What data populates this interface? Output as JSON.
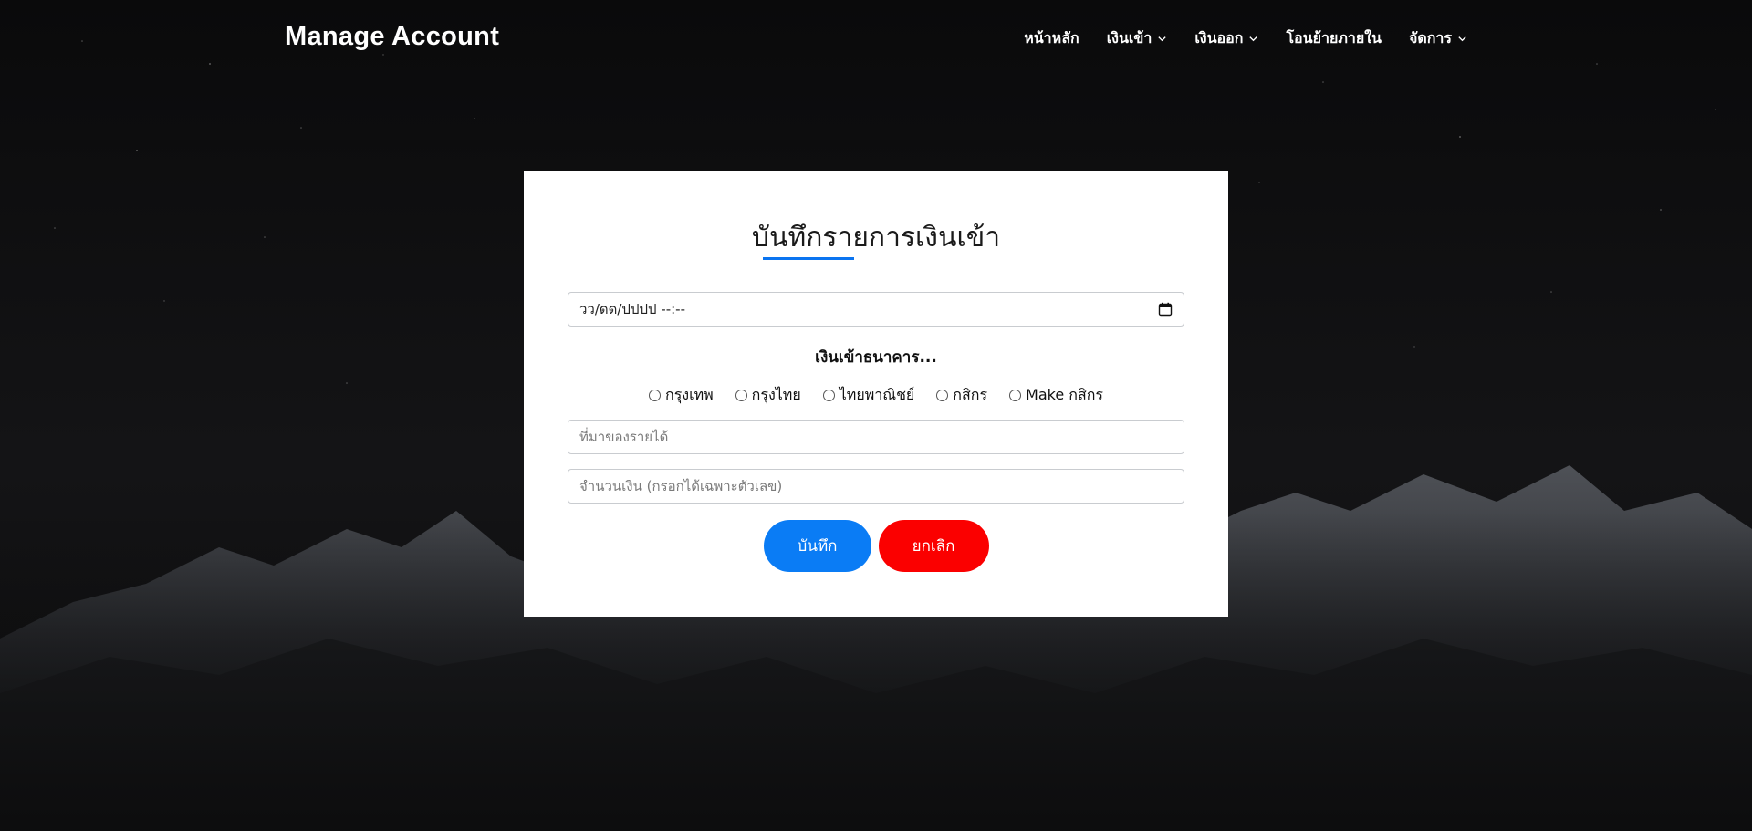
{
  "navbar": {
    "brand": "Manage Account",
    "items": [
      {
        "label": "หน้าหลัก",
        "dropdown": false
      },
      {
        "label": "เงินเข้า",
        "dropdown": true
      },
      {
        "label": "เงินออก",
        "dropdown": true
      },
      {
        "label": "โอนย้ายภายใน",
        "dropdown": false
      },
      {
        "label": "จัดการ",
        "dropdown": true
      }
    ]
  },
  "form": {
    "title": "บันทึกรายการเงินเข้า",
    "datetime_value": "วว/ดด/ปปปป --:--",
    "bank_heading": "เงินเข้าธนาคาร...",
    "banks": [
      "กรุงเทพ",
      "กรุงไทย",
      "ไทยพาณิชย์",
      "กสิกร",
      "Make กสิกร"
    ],
    "source_placeholder": "ที่มาของรายได้",
    "amount_placeholder": "จำนวนเงิน (กรอกได้เฉพาะตัวเลข)",
    "save_label": "บันทึก",
    "cancel_label": "ยกเลิก"
  },
  "colors": {
    "accent": "#0a74f0",
    "save": "#0a7cf5",
    "cancel": "#fb0000",
    "background": "#0b0b0c"
  },
  "icons": [
    "chevron-down-icon",
    "calendar-icon"
  ]
}
